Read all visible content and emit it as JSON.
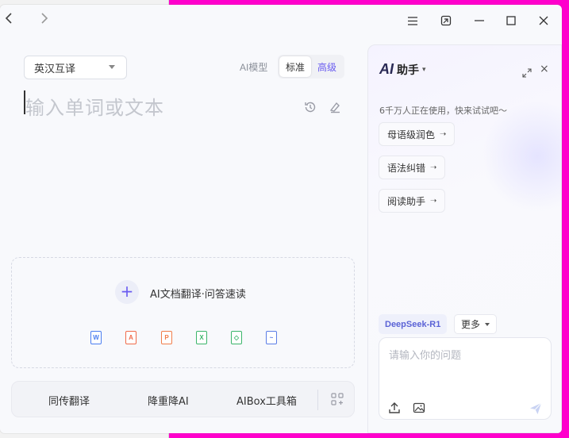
{
  "nav": {
    "back_icon": "chevron-left-icon",
    "forward_icon": "chevron-right-icon"
  },
  "window_controls": {
    "menu_icon": "hamburger-menu-icon",
    "pin_icon": "mini-window-icon",
    "minimize_icon": "minimize-icon",
    "maximize_icon": "maximize-icon",
    "close_icon": "close-icon"
  },
  "translator": {
    "language_select": "英汉互译",
    "ai_model_label": "AI模型",
    "modes": [
      {
        "label": "标准",
        "active": true
      },
      {
        "label": "高级",
        "active": false
      }
    ],
    "input_placeholder": "输入单词或文本",
    "history_icon": "history-icon",
    "clear_icon": "eraser-icon"
  },
  "document_zone": {
    "title": "AI文档翻译·问答速读",
    "plus_icon": "plus-icon",
    "file_types": [
      {
        "label": "W",
        "name": "word-file-icon",
        "color": "#4a7df0"
      },
      {
        "label": "A",
        "name": "pdf-file-icon",
        "color": "#f06b4a"
      },
      {
        "label": "P",
        "name": "ppt-file-icon",
        "color": "#f07d4a"
      },
      {
        "label": "X",
        "name": "excel-file-icon",
        "color": "#3bb56a"
      },
      {
        "label": "◇",
        "name": "ebook-file-icon",
        "color": "#3bb56a"
      },
      {
        "label": "~",
        "name": "image-file-icon",
        "color": "#5b7de6"
      }
    ]
  },
  "bottom_bar": {
    "items": [
      "同传翻译",
      "降重降AI",
      "AIBox工具箱"
    ],
    "grid_icon": "apps-grid-icon"
  },
  "assistant": {
    "logo": "AI",
    "title": "助手",
    "note": "6千万人正在使用，快来试试吧～",
    "chips": [
      "母语级润色",
      "语法纠错",
      "阅读助手"
    ],
    "model": "DeepSeek-R1",
    "more": "更多",
    "question_placeholder": "请输入你的问题",
    "upload_icon": "upload-icon",
    "image_icon": "image-icon",
    "send_icon": "send-icon"
  }
}
